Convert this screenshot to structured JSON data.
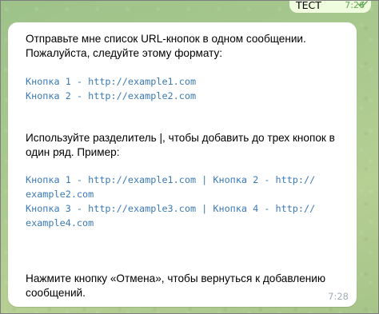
{
  "outgoing": {
    "text": "ТЕСТ",
    "time": "7:26"
  },
  "message": {
    "intro": [
      "Отправьте мне список URL-кнопок в одном сообщении.",
      "Пожалуйста, следуйте этому формату:"
    ],
    "format_lines": [
      "Кнопка 1 - http://example1.com",
      "Кнопка 2 - http://example2.com"
    ],
    "separator_text": [
      "Используйте разделитель |, чтобы добавить до трех кнопок в",
      "один ряд. Пример:"
    ],
    "example_lines": [
      "Кнопка 1 - http://example1.com | Кнопка 2 - http://",
      "example2.com",
      "Кнопка 3 - http://example3.com | Кнопка 4 - http://",
      "example4.com"
    ],
    "cancel_text": [
      "Нажмите кнопку «Отмена», чтобы вернуться к добавлению",
      "сообщений."
    ],
    "time": "7:28"
  },
  "colors": {
    "bubble_bg": "#ffffff",
    "outgoing_bg": "#effdde",
    "code_text": "#3b7ab6",
    "time_in": "#a0acb6",
    "time_out": "#5fa753"
  },
  "icons": {
    "read_status": "double-check-icon"
  }
}
